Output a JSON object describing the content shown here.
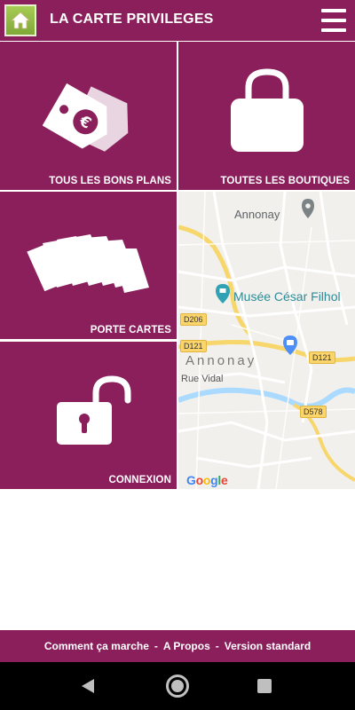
{
  "header": {
    "title": "LA CARTE PRIVILEGES",
    "home_icon": "home-icon",
    "menu_icon": "hamburger-menu-icon"
  },
  "tiles": [
    {
      "label": "TOUS LES BONS PLANS",
      "icon": "euro-price-tags-icon"
    },
    {
      "label": "TOUTES LES BOUTIQUES",
      "icon": "shopping-bag-icon"
    },
    {
      "label": "PORTE CARTES",
      "icon": "stacked-cards-icon"
    },
    {
      "label": "CONNEXION",
      "icon": "unlocked-padlock-icon"
    }
  ],
  "map": {
    "town_label": "Annonay",
    "town_label_spaced": "Annonay",
    "museum": "Musée César Filhol",
    "street": "Rue Vidal",
    "roads": [
      "D206",
      "D121",
      "D121",
      "D578"
    ],
    "attribution": "Google"
  },
  "footer": {
    "link1": "Comment ça marche",
    "sep1": "-",
    "link2": "A Propos",
    "sep2": "-",
    "link3": "Version standard"
  },
  "colors": {
    "brand": "#8a1f5c",
    "home_button": "#8db844"
  }
}
